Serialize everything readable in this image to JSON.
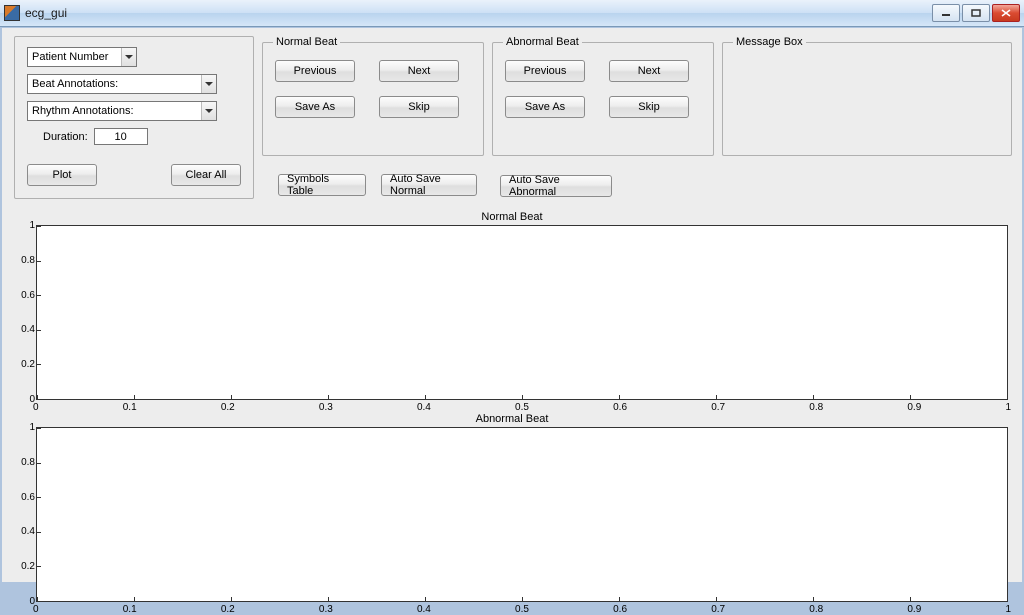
{
  "window": {
    "title": "ecg_gui"
  },
  "controls": {
    "patient_label": "Patient Number",
    "beat_label": "Beat Annotations:",
    "rhythm_label": "Rhythm Annotations:",
    "duration_label": "Duration:",
    "duration_value": "10",
    "plot": "Plot",
    "clear": "Clear All"
  },
  "normal": {
    "legend": "Normal Beat",
    "previous": "Previous",
    "next": "Next",
    "save_as": "Save As",
    "skip": "Skip"
  },
  "abnormal": {
    "legend": "Abnormal Beat",
    "previous": "Previous",
    "next": "Next",
    "save_as": "Save As",
    "skip": "Skip"
  },
  "msg": {
    "legend": "Message Box"
  },
  "aux": {
    "symbols": "Symbols Table",
    "auto_normal": "Auto Save Normal",
    "auto_abnormal": "Auto Save Abnormal"
  },
  "chart_data": [
    {
      "type": "line",
      "title": "Normal Beat",
      "x": [],
      "y": [],
      "xlim": [
        0,
        1
      ],
      "ylim": [
        0,
        1
      ],
      "xticks": [
        "0",
        "0.1",
        "0.2",
        "0.3",
        "0.4",
        "0.5",
        "0.6",
        "0.7",
        "0.8",
        "0.9",
        "1"
      ],
      "yticks": [
        "0",
        "0.2",
        "0.4",
        "0.6",
        "0.8",
        "1"
      ]
    },
    {
      "type": "line",
      "title": "Abnormal Beat",
      "x": [],
      "y": [],
      "xlim": [
        0,
        1
      ],
      "ylim": [
        0,
        1
      ],
      "xticks": [
        "0",
        "0.1",
        "0.2",
        "0.3",
        "0.4",
        "0.5",
        "0.6",
        "0.7",
        "0.8",
        "0.9",
        "1"
      ],
      "yticks": [
        "0",
        "0.2",
        "0.4",
        "0.6",
        "0.8",
        "1"
      ]
    }
  ]
}
